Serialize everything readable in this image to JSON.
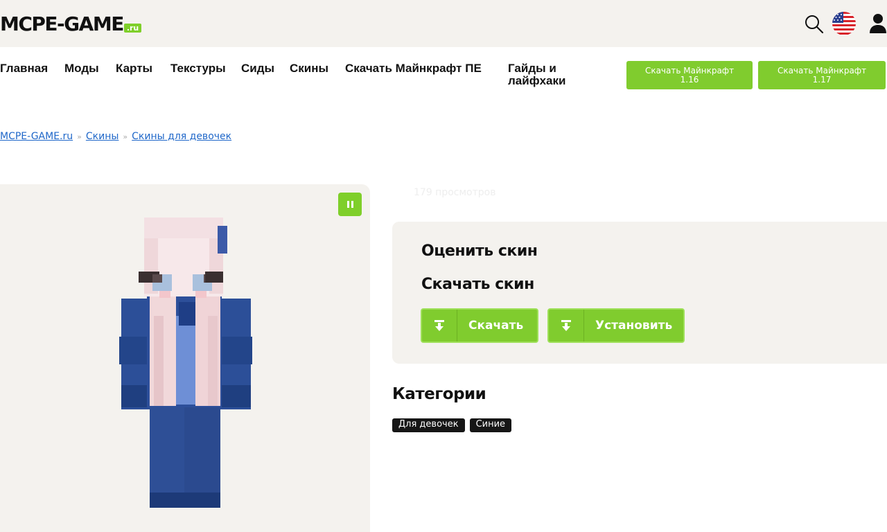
{
  "header": {
    "logo_main": "MCPE-GAME",
    "logo_suffix": ".ru",
    "icons": [
      "search-icon",
      "us-flag-icon",
      "user-icon"
    ]
  },
  "nav": {
    "items": [
      {
        "label": "Главная"
      },
      {
        "label": "Моды"
      },
      {
        "label": "Карты"
      },
      {
        "label": "Текстуры"
      },
      {
        "label": "Сиды"
      },
      {
        "label": "Скины"
      },
      {
        "label": "Скачать Майнкрафт ПЕ"
      },
      {
        "label": "Гайды и лайфхаки"
      }
    ],
    "buttons": [
      {
        "label": "Скачать Майнкрафт 1.16"
      },
      {
        "label": "Скачать Майнкрафт 1.17"
      }
    ]
  },
  "breadcrumb": {
    "items": [
      "MCPE-GAME.ru",
      "Скины",
      "Скины для девочек"
    ],
    "separator": "»"
  },
  "skin": {
    "views": "179 просмотров",
    "pause_icon": "pause-icon"
  },
  "rating": {
    "rate_title": "Оценить скин",
    "download_title": "Скачать скин",
    "download_button": "Скачать",
    "install_button": "Установить"
  },
  "categories": {
    "title": "Категории",
    "tags": [
      "Для девочек",
      "Синие"
    ]
  },
  "colors": {
    "accent_green": "#80cc2e",
    "link_blue": "#1f67c9",
    "panel_bg": "#f4f2ee",
    "tag_bg": "#161616"
  }
}
